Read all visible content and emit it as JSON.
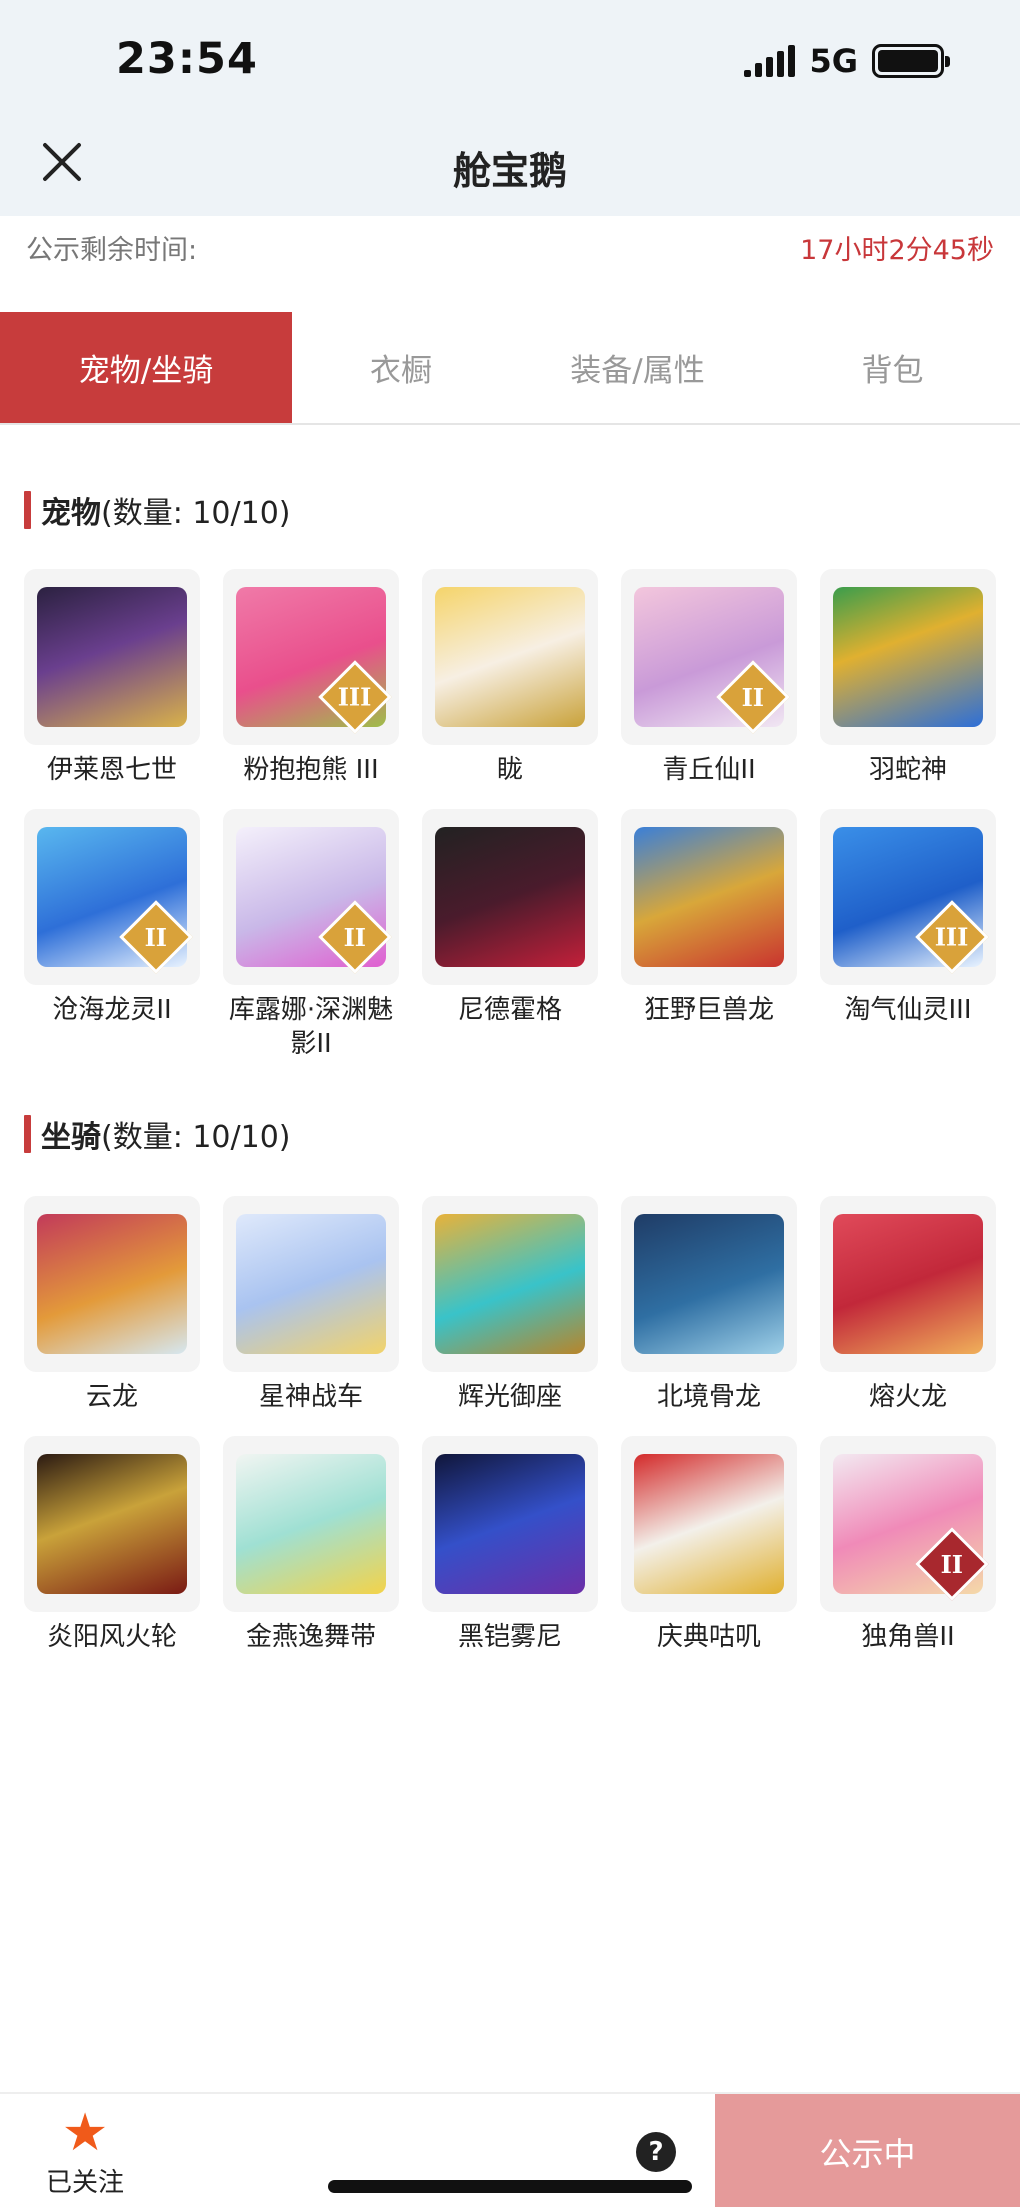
{
  "status_bar": {
    "time": "23:54",
    "network": "5G"
  },
  "header": {
    "title": "舱宝鹅"
  },
  "countdown": {
    "label": "公示剩余时间:",
    "value": "17小时2分45秒"
  },
  "tabs": [
    {
      "label": "宠物/坐骑",
      "active": true
    },
    {
      "label": "衣橱",
      "active": false
    },
    {
      "label": "装备/属性",
      "active": false
    },
    {
      "label": "背包",
      "active": false
    }
  ],
  "pets": {
    "title": "宠物",
    "count": "(数量: 10/10)",
    "items": [
      {
        "label": "伊莱恩七世",
        "icon": "pet-portrait-icon"
      },
      {
        "label": "粉抱抱熊 III",
        "icon": "pet-portrait-icon",
        "badge": "III"
      },
      {
        "label": "眬",
        "icon": "pet-portrait-icon"
      },
      {
        "label": "青丘仙II",
        "icon": "pet-portrait-icon",
        "badge": "II"
      },
      {
        "label": "羽蛇神",
        "icon": "pet-portrait-icon"
      },
      {
        "label": "沧海龙灵II",
        "icon": "pet-portrait-icon",
        "badge": "II"
      },
      {
        "label": "库露娜·深渊魅影II",
        "icon": "pet-portrait-icon",
        "badge": "II"
      },
      {
        "label": "尼德霍格",
        "icon": "pet-portrait-icon"
      },
      {
        "label": "狂野巨兽龙",
        "icon": "pet-portrait-icon"
      },
      {
        "label": "淘气仙灵III",
        "icon": "pet-portrait-icon",
        "badge": "III"
      }
    ]
  },
  "mounts": {
    "title": "坐骑",
    "count": "(数量: 10/10)",
    "items": [
      {
        "label": "云龙",
        "icon": "mount-portrait-icon"
      },
      {
        "label": "星神战车",
        "icon": "mount-portrait-icon"
      },
      {
        "label": "辉光御座",
        "icon": "mount-portrait-icon"
      },
      {
        "label": "北境骨龙",
        "icon": "mount-portrait-icon"
      },
      {
        "label": "熔火龙",
        "icon": "mount-portrait-icon"
      },
      {
        "label": "炎阳风火轮",
        "icon": "mount-portrait-icon"
      },
      {
        "label": "金燕逸舞带",
        "icon": "mount-portrait-icon"
      },
      {
        "label": "黑铠雾尼",
        "icon": "mount-portrait-icon"
      },
      {
        "label": "庆典咕叽",
        "icon": "mount-portrait-icon"
      },
      {
        "label": "独角兽II",
        "icon": "mount-portrait-icon",
        "badge": "II"
      }
    ]
  },
  "bottom_bar": {
    "follow_label": "已关注",
    "help_glyph": "?",
    "status_label": "公示中"
  },
  "colors": {
    "accent": "#c73c3c",
    "countdown": "#c8373a",
    "star": "#f05a1a",
    "status_button": "#e59a9a"
  }
}
